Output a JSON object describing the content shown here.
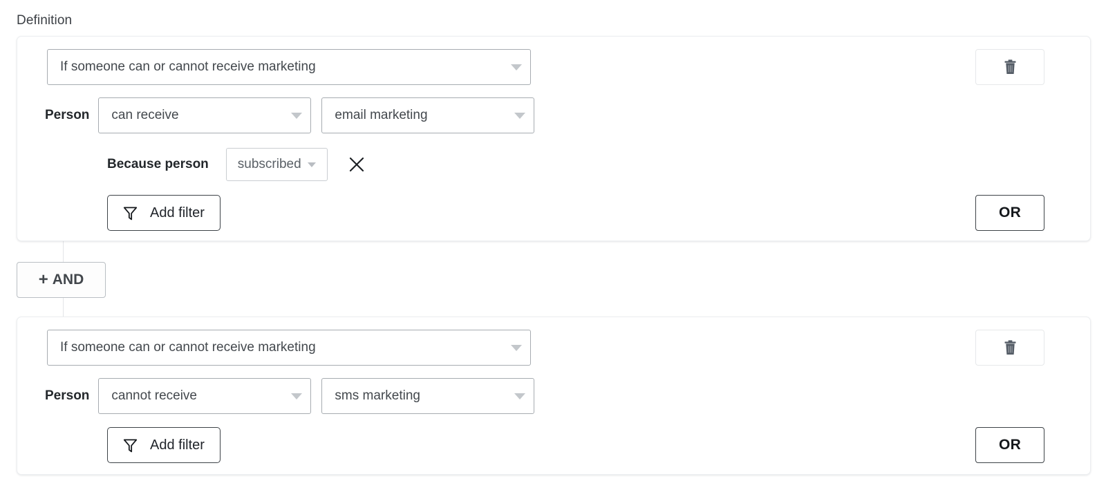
{
  "section": {
    "label": "Definition"
  },
  "and_button": {
    "plus": "+",
    "label": "AND"
  },
  "groups": [
    {
      "trigger": {
        "value": "If someone can or cannot receive marketing",
        "caret_icon": "chevron-down-icon"
      },
      "condition": {
        "subject_label": "Person",
        "operator": "can receive",
        "channel": "email marketing"
      },
      "reason": {
        "label": "Because person",
        "value": "subscribed",
        "remove_icon": "close-icon"
      },
      "add_filter": {
        "label": "Add filter",
        "icon": "filter-funnel-icon"
      },
      "delete": {
        "icon": "trash-icon"
      },
      "or": {
        "label": "OR"
      }
    },
    {
      "trigger": {
        "value": "If someone can or cannot receive marketing",
        "caret_icon": "chevron-down-icon"
      },
      "condition": {
        "subject_label": "Person",
        "operator": "cannot receive",
        "channel": "sms marketing"
      },
      "add_filter": {
        "label": "Add filter",
        "icon": "filter-funnel-icon"
      },
      "delete": {
        "icon": "trash-icon"
      },
      "or": {
        "label": "OR"
      }
    }
  ],
  "colors": {
    "page_background": "#ffffff",
    "card_border": "#eceef0",
    "select_border": "#a6abb0",
    "text_primary": "#23272b",
    "text_secondary": "#5a6066",
    "caret": "#c3c7cb",
    "outline_button_border": "#3c4146",
    "connector_line": "#e3e5e8"
  }
}
